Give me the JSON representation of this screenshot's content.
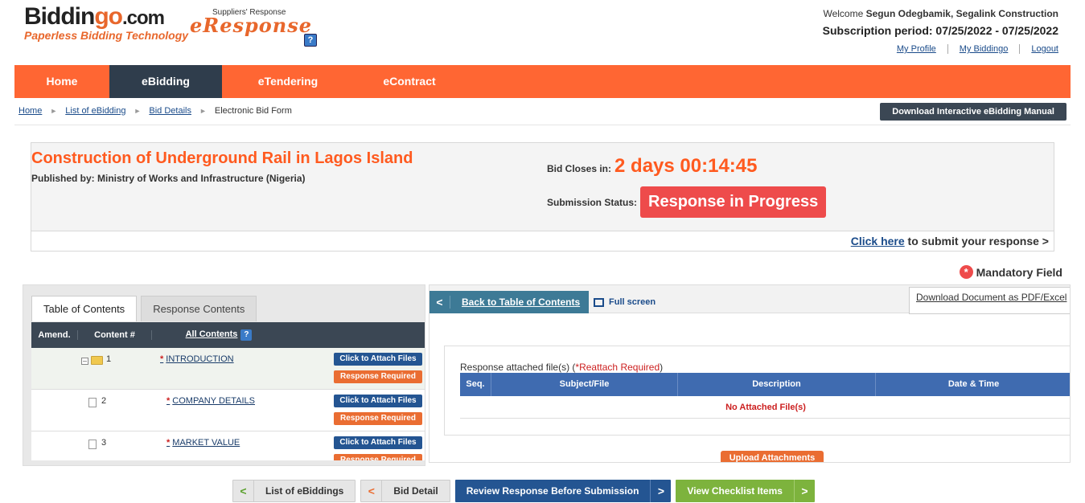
{
  "brand": {
    "logo_part1": "Biddin",
    "logo_part2": "go",
    "logo_part3": ".com",
    "tagline": "Paperless Bidding Technology",
    "eresponse_small": "Suppliers' Response",
    "eresponse_big": "eResponse",
    "help": "?"
  },
  "user": {
    "welcome_prefix": "Welcome",
    "welcome_name": "Segun Odegbamik, Segalink Construction",
    "subscription": "Subscription period: 07/25/2022 - 07/25/2022",
    "links": [
      "My Profile",
      "My Biddingo",
      "Logout"
    ]
  },
  "nav": {
    "items": [
      "Home",
      "eBidding",
      "eTendering",
      "eContract"
    ],
    "active": "eBidding"
  },
  "breadcrumb": {
    "items": [
      "Home",
      "List of eBidding",
      "Bid Details"
    ],
    "current": "Electronic Bid Form",
    "separator": "►"
  },
  "manual_button": "Download Interactive eBidding Manual",
  "project": {
    "title": "Construction of Underground Rail in Lagos Island",
    "published_by": "Published by: Ministry of Works and Infrastructure (Nigeria)",
    "closes_label": "Bid Closes in:",
    "closes_value": "2 days 00:14:45",
    "status_label": "Submission Status:",
    "status_value": "Response in Progress",
    "submit_link": "Click here",
    "submit_suffix": " to submit your response >"
  },
  "mandatory": {
    "icon": "*",
    "label": "Mandatory Field"
  },
  "toc": {
    "tabs": [
      "Table of Contents",
      "Response Contents"
    ],
    "headers": {
      "amend": "Amend.",
      "num": "Content #",
      "all": "All Contents",
      "help": "?"
    },
    "rows": [
      {
        "num": "1",
        "title": "INTRODUCTION",
        "req": "*",
        "attach": "Click to Attach Files",
        "required": "Response Required"
      },
      {
        "num": "2",
        "title": "COMPANY DETAILS",
        "req": "*",
        "attach": "Click to Attach Files",
        "required": "Response Required"
      },
      {
        "num": "3",
        "title": "MARKET VALUE",
        "req": "*",
        "attach": "Click to Attach Files",
        "required": "Response Required"
      }
    ]
  },
  "detail": {
    "back": "Back to Table of Contents",
    "back_icon": "<",
    "fullscreen": "Full screen",
    "download_pdf": "Download Document as PDF/Excel",
    "attached_title": "Response attached file(s) (",
    "reattach": "*Reattach Required",
    "attached_close": ")",
    "columns": [
      "Seq.",
      "Subject/File",
      "Description",
      "Date & Time"
    ],
    "no_files": "No Attached File(s)",
    "upload": "Upload Attachments"
  },
  "bottom": {
    "list": "List of eBiddings",
    "bid_detail": "Bid Detail",
    "review": "Review Response Before Submission",
    "checklist": "View Checklist Items",
    "icon_left": "<",
    "icon_right": ">"
  },
  "colors": {
    "accent": "#ff6633",
    "nav_active": "#2f3d4c",
    "status_red": "#ee4b4b",
    "link_blue": "#1a4b8a",
    "button_blue": "#245592",
    "button_green": "#7db33d"
  }
}
